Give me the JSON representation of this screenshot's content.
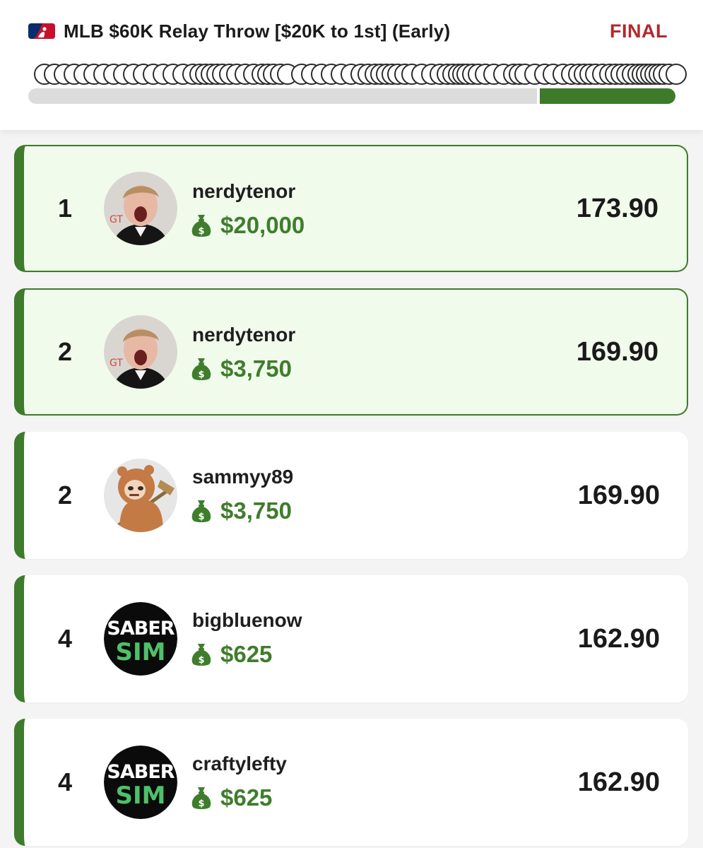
{
  "header": {
    "league_icon": "mlb-logo-icon",
    "title": "MLB $60K Relay Throw [$20K to 1st] (Early)",
    "status": "FINAL",
    "progress_fraction": 0.21
  },
  "colors": {
    "accent_green": "#3e7b2c",
    "prize_green": "#3f7d2c",
    "status_red": "#b3282d",
    "highlight_bg": "#f1fbec"
  },
  "leaderboard": [
    {
      "rank": "1",
      "username": "nerdytenor",
      "prize": "$20,000",
      "score": "173.90",
      "avatar": "person-photo",
      "highlighted": true
    },
    {
      "rank": "2",
      "username": "nerdytenor",
      "prize": "$3,750",
      "score": "169.90",
      "avatar": "person-photo",
      "highlighted": true
    },
    {
      "rank": "2",
      "username": "sammyy89",
      "prize": "$3,750",
      "score": "169.90",
      "avatar": "sloth-cartoon",
      "highlighted": false
    },
    {
      "rank": "4",
      "username": "bigbluenow",
      "prize": "$625",
      "score": "162.90",
      "avatar": "sabersim-logo",
      "highlighted": false
    },
    {
      "rank": "4",
      "username": "craftylefty",
      "prize": "$625",
      "score": "162.90",
      "avatar": "sabersim-logo",
      "highlighted": false
    }
  ],
  "logo_text": {
    "line1": "SABER",
    "line2": "SIM"
  },
  "icons": {
    "prize": "money-bag-icon"
  }
}
